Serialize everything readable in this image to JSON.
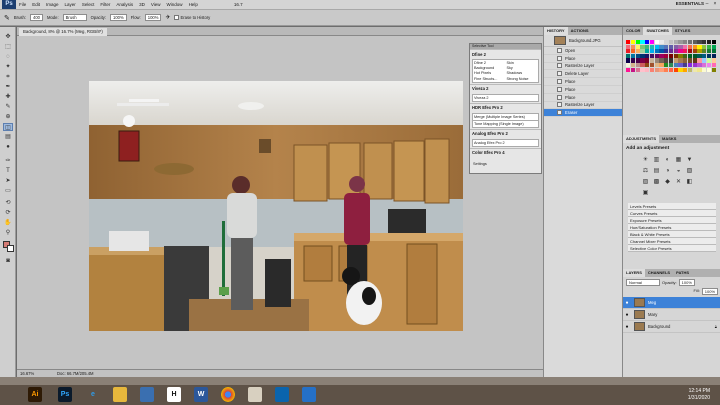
{
  "menubar": {
    "logo": "Ps",
    "items": [
      "File",
      "Edit",
      "Image",
      "Layer",
      "Select",
      "Filter",
      "Analysis",
      "3D",
      "View",
      "Window",
      "Help"
    ],
    "zoom_menu": "16.7",
    "workspace": "ESSENTIALS"
  },
  "options": {
    "brush_label": "Brush:",
    "brush_size": "400",
    "mode_label": "Mode:",
    "mode_value": "Brush",
    "opacity_label": "Opacity:",
    "opacity_value": "100%",
    "flow_label": "Flow:",
    "flow_value": "100%",
    "erase_history_label": "Erase to History"
  },
  "document": {
    "tab_title": "Background, 8% @ 16.7% (Meg, RGB/8*)",
    "zoom": "16.67%",
    "doc_size": "Doc: 66.7M/205.4M"
  },
  "fx_panel": {
    "title": "Selective Tool",
    "sections": [
      {
        "name": "Dfine 2",
        "grid": [
          "Dfine 2",
          "Skin",
          "Background",
          "Sky",
          "Hot Pixels",
          "Shadows",
          "Fine Structs...",
          "Strong Noise"
        ]
      },
      {
        "name": "Viveza 2",
        "items": [
          "Viveza 2"
        ]
      },
      {
        "name": "HDR Efex Pro 2",
        "items": [
          "Merge (Multiple Image Series)",
          "Tone Mapping (Single Image)"
        ]
      },
      {
        "name": "Analog Efex Pro 2",
        "items": [
          "Analog Efex Pro 2"
        ]
      },
      {
        "name": "Color Efex Pro 4",
        "items": []
      }
    ],
    "settings": "Settings"
  },
  "history": {
    "tabs": [
      "HISTORY",
      "ACTIONS"
    ],
    "snapshot": "Background.JPG",
    "states": [
      "Open",
      "Place",
      "Rasterize Layer",
      "Delete Layer",
      "Place",
      "Place",
      "Place",
      "Rasterize Layer",
      "Eraser"
    ],
    "current_state": "Eraser"
  },
  "right_dock": {
    "color_tabs": [
      "COLOR",
      "SWATCHES",
      "STYLES"
    ],
    "adjust_tabs": [
      "ADJUSTMENTS",
      "MASKS"
    ],
    "adjust_title": "Add an adjustment",
    "adjust_icons": [
      "☀",
      "▥",
      "◐",
      "▦",
      "▼",
      "⚖",
      "▤",
      "◑",
      "◒",
      "▧",
      "▨",
      "▩",
      "◆",
      "✕",
      "◧",
      "▣"
    ],
    "presets": [
      "Levels Presets",
      "Curves Presets",
      "Exposure Presets",
      "Hue/Saturation Presets",
      "Black & White Presets",
      "Channel Mixer Presets",
      "Selective Color Presets"
    ],
    "layer_tabs": [
      "LAYERS",
      "CHANNELS",
      "PATHS"
    ],
    "blend_mode": "Normal",
    "opacity_label": "Opacity:",
    "opacity_value": "100%",
    "fill_label": "Fill:",
    "fill_value": "100%",
    "layers": [
      {
        "name": "Meg",
        "selected": true
      },
      {
        "name": "Mary",
        "selected": false
      },
      {
        "name": "Background",
        "selected": false
      }
    ]
  },
  "taskbar": {
    "apps": [
      "Ai",
      "Ps",
      "e",
      "folder",
      "store",
      "H",
      "W",
      "chrome",
      "paint",
      "mail",
      "photos"
    ],
    "time": "12:14 PM",
    "date": "1/31/2020"
  },
  "colors": {
    "accent": "#3d82d8",
    "panel": "#d6d6d6",
    "wood": "#b98a4f"
  }
}
